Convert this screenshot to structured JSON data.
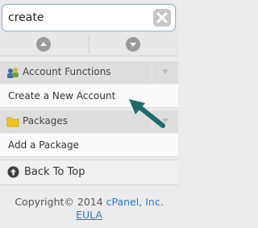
{
  "search": {
    "value": "create"
  },
  "sections": [
    {
      "label": "Account Functions",
      "icon": "account-functions-icon"
    },
    {
      "label": "Packages",
      "icon": "packages-folder-icon"
    }
  ],
  "items": [
    {
      "label": "Create a New Account"
    },
    {
      "label": "Add a Package"
    }
  ],
  "back_to_top": {
    "label": "Back To Top"
  },
  "footer": {
    "copyright_prefix": "Copyright© 2014 ",
    "company_link": "cPanel, Inc.",
    "eula_link": "EULA"
  },
  "colors": {
    "accent": "#1f6b6b",
    "link": "#2e77c8",
    "folder": "#f0c419"
  }
}
